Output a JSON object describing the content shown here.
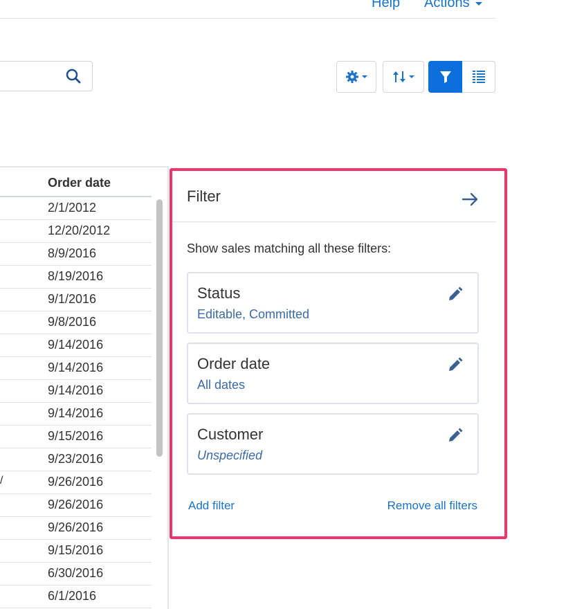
{
  "nav": {
    "help_label": "Help",
    "actions_label": "Actions"
  },
  "table": {
    "header": "Order date",
    "rows": [
      {
        "prefix": "",
        "order_date": "2/1/2012"
      },
      {
        "prefix": "",
        "order_date": "12/20/2012"
      },
      {
        "prefix": "",
        "order_date": "8/9/2016"
      },
      {
        "prefix": "",
        "order_date": "8/19/2016"
      },
      {
        "prefix": "",
        "order_date": "9/1/2016"
      },
      {
        "prefix": "",
        "order_date": "9/8/2016"
      },
      {
        "prefix": "",
        "order_date": "9/14/2016"
      },
      {
        "prefix": "",
        "order_date": "9/14/2016"
      },
      {
        "prefix": "",
        "order_date": "9/14/2016"
      },
      {
        "prefix": "",
        "order_date": "9/14/2016"
      },
      {
        "prefix": "",
        "order_date": "9/15/2016"
      },
      {
        "prefix": "",
        "order_date": "9/23/2016"
      },
      {
        "prefix": "/",
        "order_date": "9/26/2016"
      },
      {
        "prefix": "",
        "order_date": "9/26/2016"
      },
      {
        "prefix": "",
        "order_date": "9/26/2016"
      },
      {
        "prefix": "",
        "order_date": "9/15/2016"
      },
      {
        "prefix": "",
        "order_date": "6/30/2016"
      },
      {
        "prefix": "",
        "order_date": "6/1/2016"
      }
    ]
  },
  "filter_panel": {
    "title": "Filter",
    "subtitle": "Show sales matching all these filters:",
    "filters": [
      {
        "name": "Status",
        "value": "Editable, Committed",
        "italic": false
      },
      {
        "name": "Order date",
        "value": "All dates",
        "italic": false
      },
      {
        "name": "Customer",
        "value": "Unspecified",
        "italic": true
      }
    ],
    "add_filter_label": "Add filter",
    "remove_all_label": "Remove all filters"
  },
  "colors": {
    "accent": "#0b6fdc",
    "link": "#1a73c9",
    "highlight_border": "#f1346a",
    "filter_value": "#3c6aa3"
  }
}
